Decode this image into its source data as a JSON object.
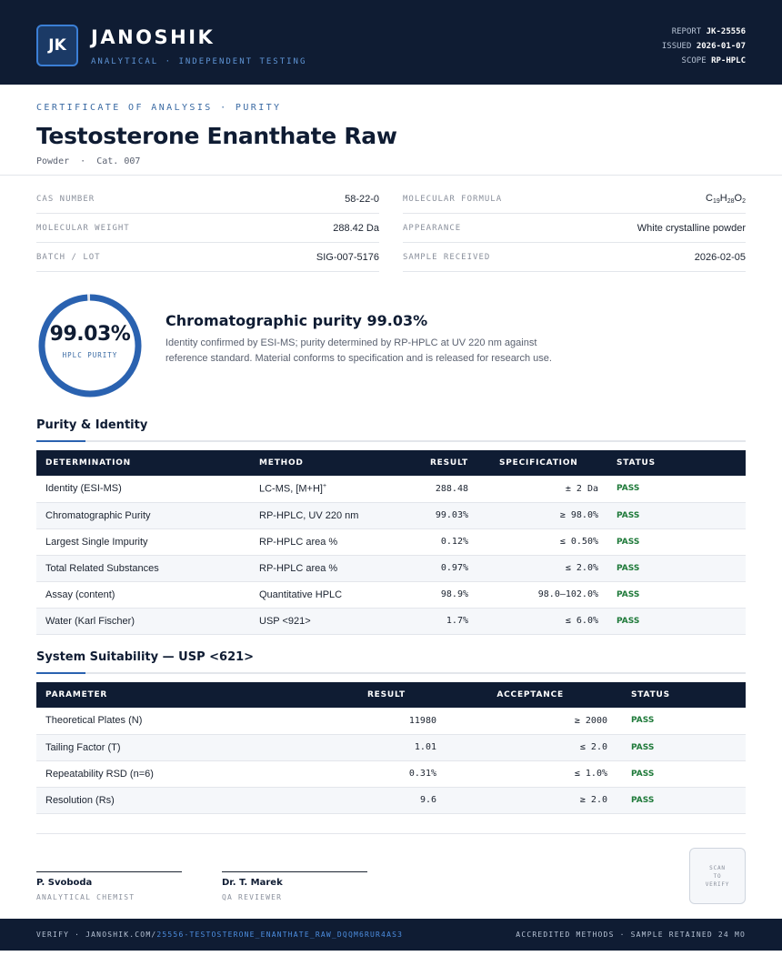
{
  "header": {
    "logo_initials": "JK",
    "brand": "JANOSHIK",
    "tagline": "ANALYTICAL · INDEPENDENT TESTING",
    "report_label": "REPORT",
    "report_id": "JK-25556",
    "issued_label": "ISSUED",
    "issued_date": "2026-01-07",
    "scope_label": "SCOPE",
    "scope_value": "RP-HPLC"
  },
  "document": {
    "eyebrow": "CERTIFICATE OF ANALYSIS · PURITY",
    "title": "Testosterone Enanthate Raw",
    "subtitle": "Powder  ·  Cat. 007"
  },
  "specs": {
    "left": [
      {
        "label": "CAS NUMBER",
        "value": "58-22-0"
      },
      {
        "label": "MOLECULAR WEIGHT",
        "value": "288.42 Da"
      },
      {
        "label": "BATCH / LOT",
        "value": "SIG-007-5176"
      }
    ],
    "right": [
      {
        "label": "MOLECULAR FORMULA",
        "formula": {
          "c": "C",
          "c_n": "19",
          "h": "H",
          "h_n": "28",
          "o": "O",
          "o_n": "2"
        }
      },
      {
        "label": "APPEARANCE",
        "value": "White crystalline powder"
      },
      {
        "label": "SAMPLE RECEIVED",
        "value": "2026-02-05"
      }
    ]
  },
  "summary": {
    "purity_value": "99.03%",
    "purity_fraction": 0.9903,
    "gauge_label": "HPLC PURITY",
    "heading": "Chromatographic purity 99.03%",
    "body": "Identity confirmed by ESI-MS; purity determined by RP-HPLC at UV 220 nm against reference standard. Material conforms to specification and is released for research use."
  },
  "purity_table": {
    "title": "Purity & Identity",
    "headers": [
      "DETERMINATION",
      "METHOD",
      "RESULT",
      "SPECIFICATION",
      "STATUS"
    ],
    "rows": [
      {
        "determination": "Identity (ESI-MS)",
        "method": "LC-MS, [M+H]",
        "method_sup": "+",
        "result": "288.48",
        "spec": "± 2 Da",
        "status": "PASS"
      },
      {
        "determination": "Chromatographic Purity",
        "method": "RP-HPLC, UV 220 nm",
        "result": "99.03%",
        "spec": "≥ 98.0%",
        "status": "PASS"
      },
      {
        "determination": "Largest Single Impurity",
        "method": "RP-HPLC area %",
        "result": "0.12%",
        "spec": "≤ 0.50%",
        "status": "PASS"
      },
      {
        "determination": "Total Related Substances",
        "method": "RP-HPLC area %",
        "result": "0.97%",
        "spec": "≤ 2.0%",
        "status": "PASS"
      },
      {
        "determination": "Assay (content)",
        "method": "Quantitative HPLC",
        "result": "98.9%",
        "spec": "98.0–102.0%",
        "status": "PASS"
      },
      {
        "determination": "Water (Karl Fischer)",
        "method": "USP <921>",
        "result": "1.7%",
        "spec": "≤ 6.0%",
        "status": "PASS"
      }
    ]
  },
  "suitability_table": {
    "title": "System Suitability — USP <621>",
    "headers": [
      "PARAMETER",
      "RESULT",
      "ACCEPTANCE",
      "STATUS"
    ],
    "rows": [
      {
        "parameter": "Theoretical Plates (N)",
        "result": "11980",
        "acceptance": "≥ 2000",
        "status": "PASS"
      },
      {
        "parameter": "Tailing Factor (T)",
        "result": "1.01",
        "acceptance": "≤ 2.0",
        "status": "PASS"
      },
      {
        "parameter": "Repeatability RSD (n=6)",
        "result": "0.31%",
        "acceptance": "≤ 1.0%",
        "status": "PASS"
      },
      {
        "parameter": "Resolution (Rs)",
        "result": "9.6",
        "acceptance": "≥ 2.0",
        "status": "PASS"
      }
    ]
  },
  "signatures": [
    {
      "name": "P. Svoboda",
      "role": "ANALYTICAL CHEMIST"
    },
    {
      "name": "Dr. T. Marek",
      "role": "QA REVIEWER"
    }
  ],
  "qr": {
    "l1": "SCAN",
    "l2": "TO",
    "l3": "VERIFY"
  },
  "footer": {
    "verify_prefix": "VERIFY · JANOSHIK.COM/",
    "verify_link": "25556-TESTOSTERONE_ENANTHATE_RAW_DQQM6RUR4AS3",
    "right": "ACCREDITED METHODS · SAMPLE RETAINED 24 MO"
  },
  "colors": {
    "navy": "#0f1c33",
    "accent_blue": "#2a62b0",
    "pass_green": "#1f7a3a"
  }
}
